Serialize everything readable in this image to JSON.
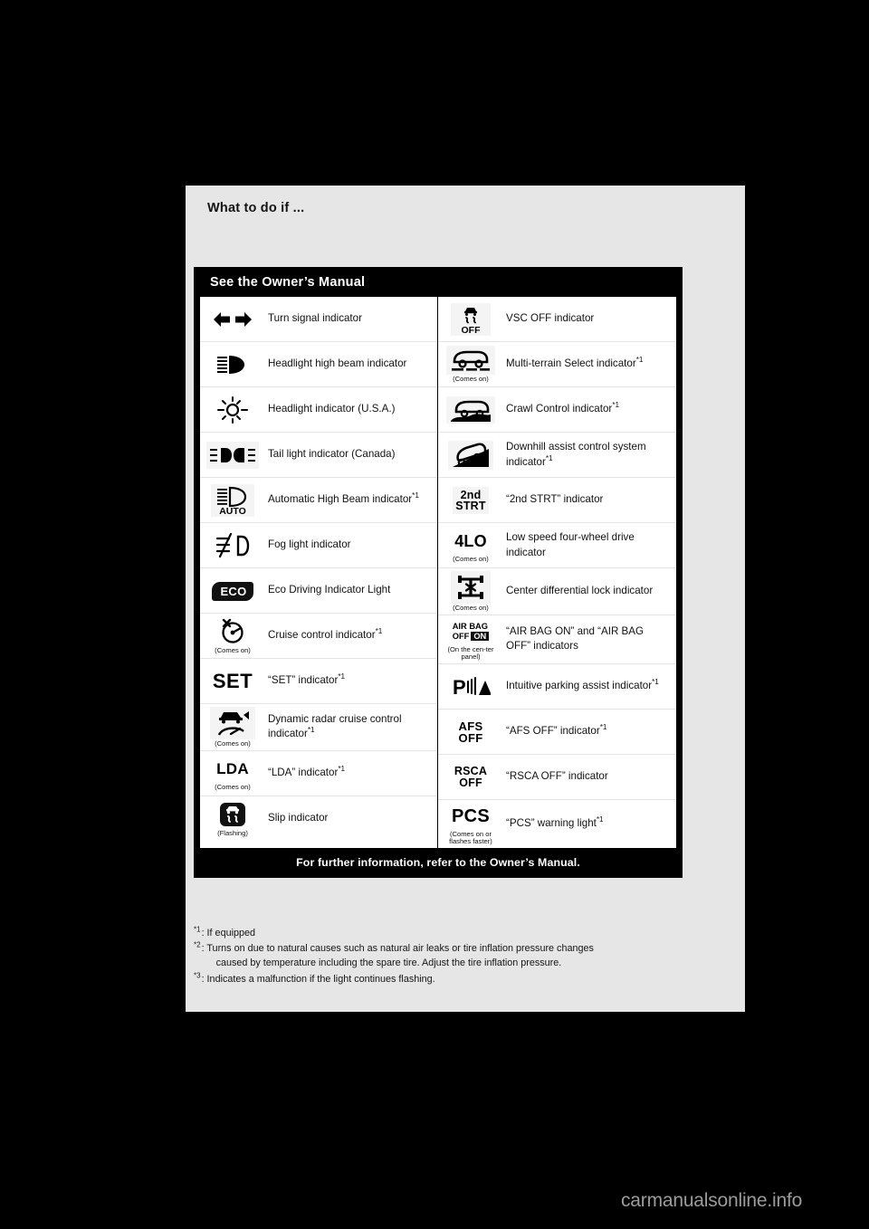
{
  "tab": {
    "title": "What to do if ..."
  },
  "card": {
    "header": "See the Owner’s Manual",
    "footer": "For further information, refer to the Owner’s Manual."
  },
  "left_column": [
    {
      "icon": "turn-signal-icon",
      "label": "Turn signal indicator",
      "sup": "",
      "note": ""
    },
    {
      "icon": "high-beam-icon",
      "label": "Headlight high beam indicator",
      "sup": "",
      "note": ""
    },
    {
      "icon": "headlight-icon",
      "label": "Headlight indicator (U.S.A.)",
      "sup": "",
      "note": ""
    },
    {
      "icon": "tail-light-icon",
      "label": "Tail light indicator (Canada)",
      "sup": "",
      "note": ""
    },
    {
      "icon": "auto-high-beam-icon",
      "label": "Automatic High Beam indicator",
      "sup": "*1",
      "note": ""
    },
    {
      "icon": "fog-light-icon",
      "label": "Fog light indicator",
      "sup": "",
      "note": ""
    },
    {
      "icon": "eco-icon",
      "label": "Eco Driving Indicator Light",
      "sup": "",
      "note": ""
    },
    {
      "icon": "cruise-control-icon",
      "label": "Cruise control indicator",
      "sup": "*1",
      "note": "(Comes on)"
    },
    {
      "icon": "set-icon",
      "label": "“SET” indicator",
      "sup": "*1",
      "note": ""
    },
    {
      "icon": "dynamic-radar-cruise-icon",
      "label": "Dynamic radar cruise control indicator",
      "sup": "*1",
      "note": "(Comes on)"
    },
    {
      "icon": "lda-icon",
      "label": "“LDA” indicator",
      "sup": "*1",
      "note": "(Comes on)"
    },
    {
      "icon": "slip-indicator-icon",
      "label": "Slip indicator",
      "sup": "",
      "note": "(Flashing)"
    }
  ],
  "right_column": [
    {
      "icon": "vsc-off-icon",
      "label": "VSC OFF indicator",
      "sup": "",
      "note": ""
    },
    {
      "icon": "multi-terrain-select-icon",
      "label": "Multi-terrain Select indicator",
      "sup": "*1",
      "note": "(Comes on)"
    },
    {
      "icon": "crawl-control-icon",
      "label": "Crawl Control indicator",
      "sup": "*1",
      "note": ""
    },
    {
      "icon": "downhill-assist-icon",
      "label": "Downhill assist control system  indicator",
      "sup": "*1",
      "note": ""
    },
    {
      "icon": "second-start-icon",
      "label": "“2nd STRT” indicator",
      "sup": "",
      "note": ""
    },
    {
      "icon": "four-lo-icon",
      "label": "Low speed four-wheel drive indicator",
      "sup": "",
      "note": "(Comes on)"
    },
    {
      "icon": "center-diff-lock-icon",
      "label": "Center differential lock indicator",
      "sup": "",
      "note": "(Comes on)"
    },
    {
      "icon": "air-bag-on-off-icon",
      "label": "“AIR BAG ON” and “AIR BAG OFF” indicators",
      "sup": "",
      "note": "(On the cen-ter panel)"
    },
    {
      "icon": "intuitive-parking-assist-icon",
      "label": "Intuitive parking assist indicator",
      "sup": "*1",
      "note": ""
    },
    {
      "icon": "afs-off-icon",
      "label": "“AFS OFF” indicator",
      "sup": "*1",
      "note": ""
    },
    {
      "icon": "rsca-off-icon",
      "label": "“RSCA OFF” indicator",
      "sup": "",
      "note": ""
    },
    {
      "icon": "pcs-icon",
      "label": "“PCS” warning light",
      "sup": "*1",
      "note": "(Comes on or flashes faster)"
    }
  ],
  "icon_text": {
    "vsc_off": "OFF",
    "second_start_top": "2nd",
    "second_start_bottom": "STRT",
    "four_lo": "4LO",
    "air_bag_line1": "AIR BAG",
    "air_bag_line2": "OFF",
    "air_bag_on": "ON",
    "afs_top": "AFS",
    "afs_bottom": "OFF",
    "rsca_top": "RSCA",
    "rsca_bottom": "OFF",
    "pcs": "PCS",
    "set": "SET",
    "lda": "LDA",
    "eco": "ECO",
    "auto": "AUTO"
  },
  "notes": [
    {
      "marker": "*1",
      "text": ": If equipped",
      "indent": ""
    },
    {
      "marker": "*2",
      "text": ": Turns on due to natural causes such as natural air leaks or tire inflation pressure changes",
      "indent": "caused by temperature including the spare tire. Adjust the tire inflation pressure."
    },
    {
      "marker": "*3",
      "text": ": Indicates a malfunction if the light continues flashing.",
      "indent": ""
    }
  ],
  "watermark": "carmanualsonline.info",
  "colors": {
    "page_bg": "#e6e6e6",
    "card_bg": "#000000",
    "table_bg": "#ffffff",
    "icon_cell_bg": "#f4f4f4"
  }
}
